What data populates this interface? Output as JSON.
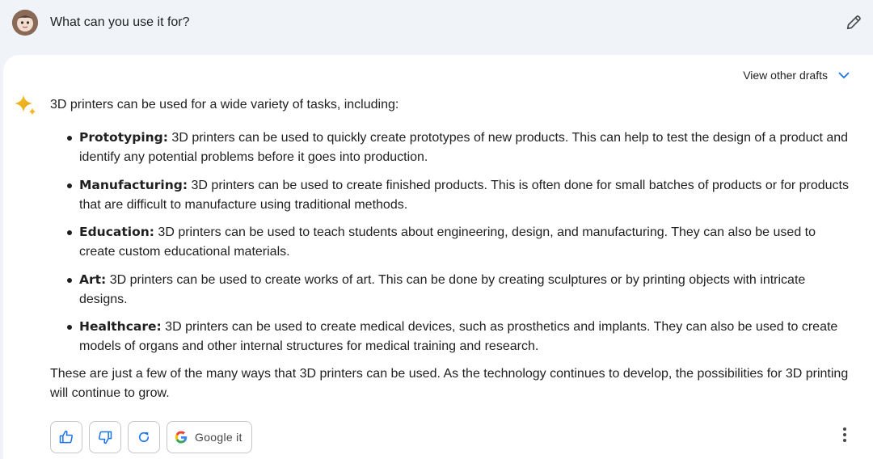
{
  "prompt": {
    "text": "What can you use it for?"
  },
  "response": {
    "view_drafts_label": "View other drafts",
    "intro": "3D printers can be used for a wide variety of tasks, including:",
    "items": [
      {
        "term": "Prototyping:",
        "text": " 3D printers can be used to quickly create prototypes of new products. This can help to test the design of a product and identify any potential problems before it goes into production."
      },
      {
        "term": "Manufacturing:",
        "text": " 3D printers can be used to create finished products. This is often done for small batches of products or for products that are difficult to manufacture using traditional methods."
      },
      {
        "term": "Education:",
        "text": " 3D printers can be used to teach students about engineering, design, and manufacturing. They can also be used to create custom educational materials."
      },
      {
        "term": "Art:",
        "text": " 3D printers can be used to create works of art. This can be done by creating sculptures or by printing objects with intricate designs."
      },
      {
        "term": "Healthcare:",
        "text": " 3D printers can be used to create medical devices, such as prosthetics and implants. They can also be used to create models of organs and other internal structures for medical training and research."
      }
    ],
    "outro": "These are just a few of the many ways that 3D printers can be used. As the technology continues to develop, the possibilities for 3D printing will continue to grow."
  },
  "actions": {
    "google_it_label": "Google it",
    "icons": [
      "thumbs-up-icon",
      "thumbs-down-icon",
      "regenerate-icon",
      "google-logo-icon",
      "more-vert-icon"
    ]
  },
  "colors": {
    "page_background": "#f0f4f9",
    "card_background": "#ffffff",
    "accent_blue": "#1a73e8",
    "text": "#1f1f1f",
    "button_border": "#c4c7c5"
  }
}
